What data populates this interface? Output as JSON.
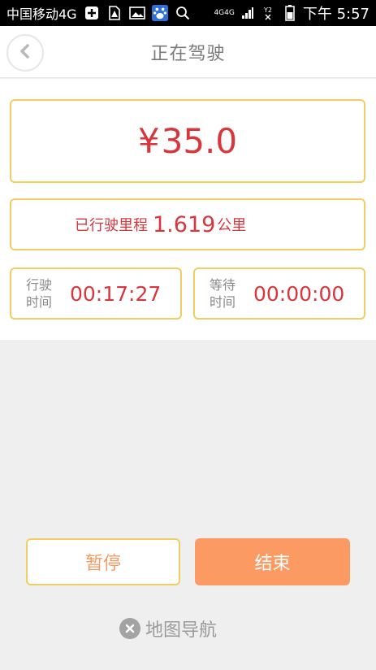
{
  "status_bar": {
    "carrier": "中国移动4G",
    "network_small": "4G4G",
    "sim_small": "¥?2",
    "time": "下午 5:57"
  },
  "header": {
    "title": "正在驾驶"
  },
  "fare": {
    "currency": "¥",
    "amount": "35.0"
  },
  "distance": {
    "label": "已行驶里程",
    "value": "1.619",
    "unit": "公里"
  },
  "drive_time": {
    "label": "行驶\n时间",
    "value": "00:17:27"
  },
  "wait_time": {
    "label": "等待\n时间",
    "value": "00:00:00"
  },
  "buttons": {
    "pause": "暂停",
    "end": "结束"
  },
  "navigation": {
    "label": "地图导航",
    "icon": "close-circle-icon"
  },
  "colors": {
    "accent_red": "#d8363c",
    "border_yellow": "#f1cd64",
    "button_orange": "#fb9a63",
    "status_bg": "#000000"
  }
}
